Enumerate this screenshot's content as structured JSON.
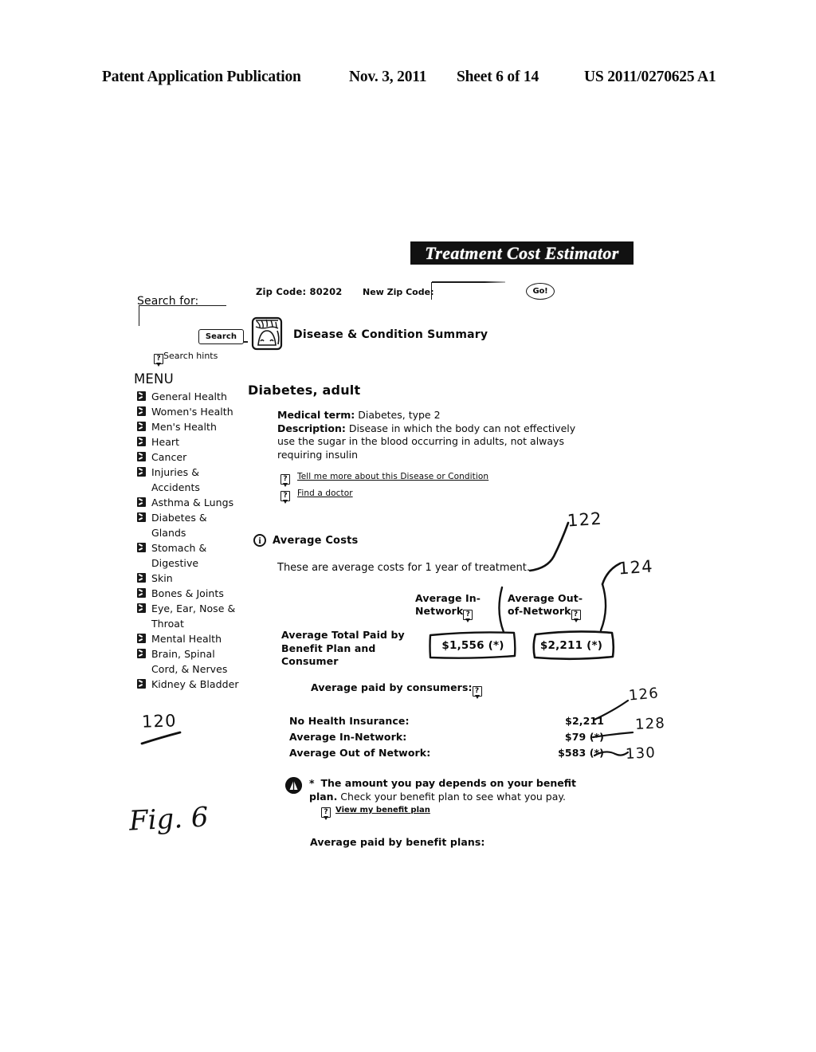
{
  "patent_header": {
    "publication": "Patent Application Publication",
    "date": "Nov. 3, 2011",
    "sheet": "Sheet 6 of 14",
    "number": "US 2011/0270625 A1"
  },
  "app": {
    "banner_title": "Treatment Cost Estimator"
  },
  "zip_bar": {
    "zip_code_label": "Zip Code: 80202",
    "new_zip_label": "New Zip Code:",
    "new_zip_value": "",
    "new_zip_placeholder": "",
    "go_label": "Go!"
  },
  "search": {
    "label": "Search for:",
    "value": "",
    "placeholder": "",
    "button_label": "Search",
    "hints_label": "Search hints",
    "hints_icon": "question-callout-icon"
  },
  "section_header": {
    "icon": "disease-summary-icon",
    "title": "Disease & Condition Summary"
  },
  "menu": {
    "heading": "MENU",
    "bullet_icon": "menu-arrow-bullet-icon",
    "items": [
      {
        "label": "General Health"
      },
      {
        "label": "Women's Health"
      },
      {
        "label": "Men's Health"
      },
      {
        "label": "Heart"
      },
      {
        "label": "Cancer"
      },
      {
        "label": "Injuries &",
        "label2": "Accidents"
      },
      {
        "label": "Asthma & Lungs"
      },
      {
        "label": "Diabetes &",
        "label2": "Glands"
      },
      {
        "label": "Stomach &",
        "label2": "Digestive"
      },
      {
        "label": "Skin"
      },
      {
        "label": "Bones & Joints"
      },
      {
        "label": "Eye, Ear, Nose &",
        "label2": "Throat"
      },
      {
        "label": "Mental Health"
      },
      {
        "label": "Brain, Spinal",
        "label2": "Cord, & Nerves"
      },
      {
        "label": "Kidney & Bladder"
      }
    ]
  },
  "content": {
    "page_title": "Diabetes, adult",
    "medical_term_label": "Medical term:",
    "medical_term_value": " Diabetes, type 2",
    "description_label": "Description:",
    "description_value": " Disease in which the body can not effectively use the sugar in the blood occurring in adults, not always requiring insulin",
    "link_more": "Tell me more about this Disease or Condition",
    "link_doctor": "Find a doctor"
  },
  "average_costs": {
    "icon": "info-circle-icon",
    "heading": "Average Costs",
    "subtitle": "These are average costs for 1 year of treatment.",
    "col_in_network": "Average In-Network",
    "col_out_of_network": "Average Out-of-Network",
    "row_label": "Average Total Paid by Benefit Plan and Consumer",
    "value_in_network": "$1,556  (*)",
    "value_out_of_network": "$2,211  (*)"
  },
  "consumer_costs": {
    "heading": "Average paid by consumers:",
    "rows": [
      {
        "label": "No Health Insurance:",
        "value": "$2,211"
      },
      {
        "label": "Average In-Network:",
        "value": "$79 (*)"
      },
      {
        "label": "Average Out of Network:",
        "value": "$583 (*)"
      }
    ]
  },
  "disclaimer": {
    "icon": "warning-circle-icon",
    "asterisk": "*",
    "bold_text": "The amount you pay depends on your benefit plan.",
    "rest_text": " Check your benefit plan to see what you pay.",
    "link": "View my benefit plan"
  },
  "benefit_plans": {
    "heading": "Average paid by benefit plans:"
  },
  "annotations": {
    "ref_120": "120",
    "ref_122": "122",
    "ref_124": "124",
    "ref_126": "126",
    "ref_128": "128",
    "ref_130": "130",
    "figure_label": "Fig. 6"
  }
}
